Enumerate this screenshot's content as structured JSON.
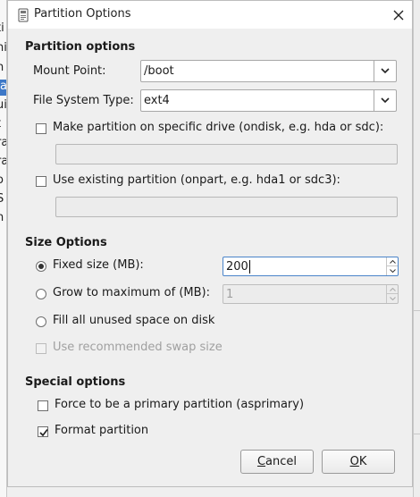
{
  "background": {
    "left_fragments": [
      "ti",
      "hi",
      "n",
      "ra",
      "ui",
      "t",
      "ra",
      "ra",
      "o",
      "S",
      "n"
    ],
    "selected_fragment": "a"
  },
  "dialog": {
    "title": "Partition Options",
    "title_icon": "app-icon",
    "close_icon": "close-icon"
  },
  "partition_options": {
    "heading": "Partition options",
    "mount_point_label": "Mount Point:",
    "mount_point_value": "/boot",
    "fs_type_label": "File System Type:",
    "fs_type_value": "ext4",
    "ondisk_label": "Make partition on specific drive (ondisk, e.g. hda or sdc):",
    "ondisk_checked": false,
    "ondisk_value": "",
    "onpart_label": "Use existing partition (onpart, e.g. hda1 or sdc3):",
    "onpart_checked": false,
    "onpart_value": ""
  },
  "size_options": {
    "heading": "Size Options",
    "fixed_label": "Fixed size (MB):",
    "fixed_value": "200",
    "fixed_selected": true,
    "grow_label": "Grow to maximum of (MB):",
    "grow_value": "1",
    "grow_selected": false,
    "fill_label": "Fill all unused space on disk",
    "fill_selected": false,
    "swap_label": "Use recommended swap size",
    "swap_checked": false
  },
  "special_options": {
    "heading": "Special options",
    "primary_label": "Force to be a primary partition (asprimary)",
    "primary_checked": false,
    "format_label": "Format partition",
    "format_checked": true
  },
  "buttons": {
    "cancel_mnemonic": "C",
    "cancel_rest": "ancel",
    "ok_mnemonic": "O",
    "ok_rest": "K"
  },
  "colors": {
    "accent": "#4a84c9",
    "selection": "#3d78c7"
  }
}
